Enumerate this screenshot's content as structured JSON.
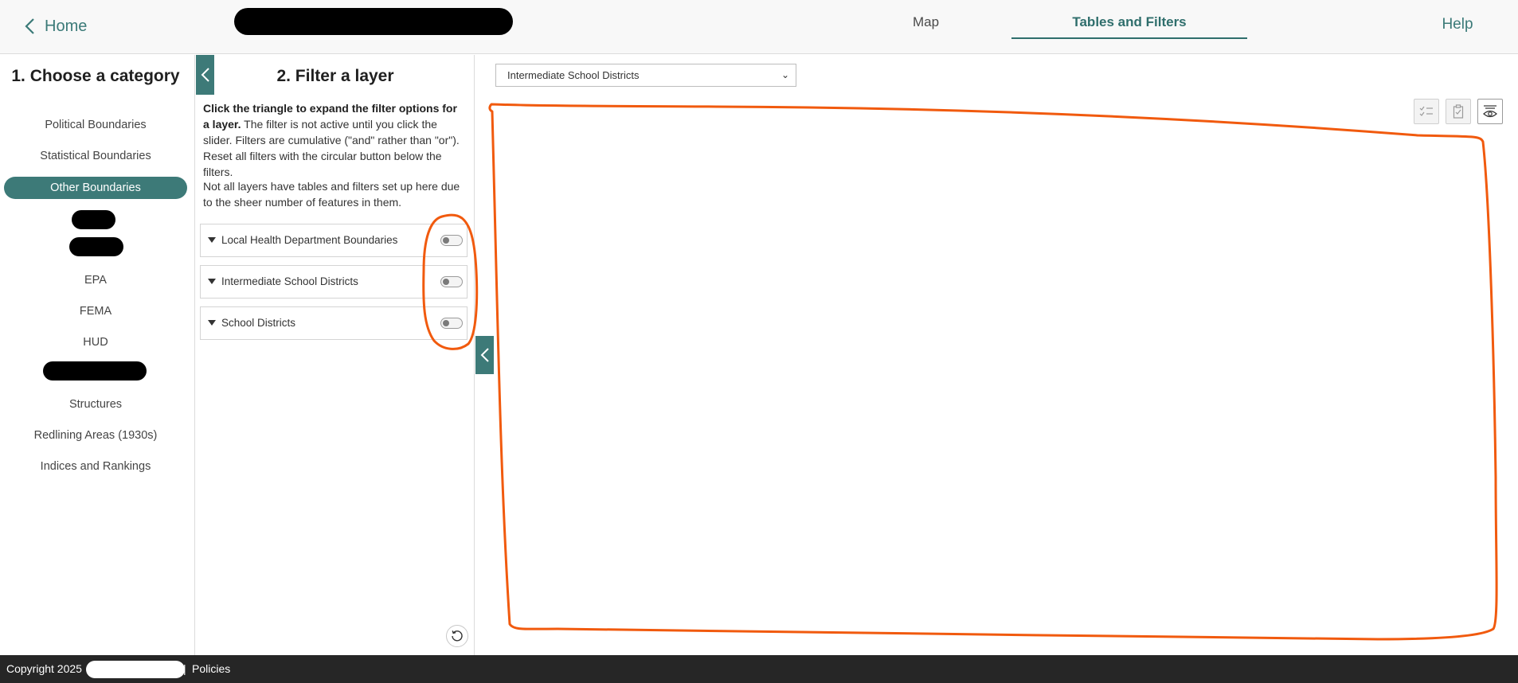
{
  "header": {
    "home_label": "Home",
    "tabs": {
      "map": "Map",
      "tables": "Tables and Filters"
    },
    "help_label": "Help"
  },
  "categories": {
    "title": "1. Choose a category",
    "items": {
      "political": "Political Boundaries",
      "statistical": "Statistical Boundaries",
      "other": "Other Boundaries",
      "epa": "EPA",
      "fema": "FEMA",
      "hud": "HUD",
      "structures": "Structures",
      "redlining": "Redlining Areas (1930s)",
      "indices": "Indices and Rankings"
    },
    "active": "Other Boundaries"
  },
  "filters": {
    "title": "2. Filter a layer",
    "instructions_bold": "Click the triangle to expand the filter options for a layer.",
    "instructions_rest": " The filter is not active until you click the slider. Filters are cumulative (\"and\" rather than \"or\"). Reset all filters with the circular button below the filters.",
    "note": "Not all layers have tables and filters set up here due to the sheer number of features in them.",
    "layers": [
      {
        "name": "Local Health Department Boundaries",
        "enabled": false
      },
      {
        "name": "Intermediate School Districts",
        "enabled": false
      },
      {
        "name": "School Districts",
        "enabled": false
      }
    ]
  },
  "table": {
    "selected_layer": "Intermediate School Districts"
  },
  "footer": {
    "copyright": "Copyright 2025",
    "separator": "|",
    "policies": "Policies"
  },
  "colors": {
    "accent": "#3d7a78",
    "annotation": "#f15a0e",
    "footer_bg": "#262626"
  }
}
